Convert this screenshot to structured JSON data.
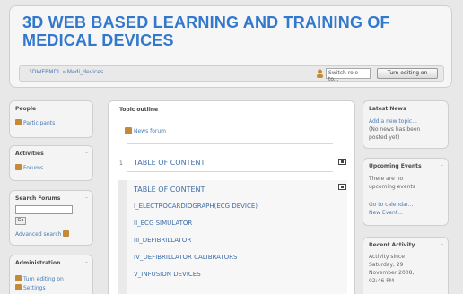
{
  "header": {
    "site_title": "3D WEB BASED LEARNING AND TRAINING OF MEDICAL DEVICES",
    "breadcrumb": "3DWEBMDL » Medi_devices",
    "role_select": "Switch role to...",
    "edit_button": "Turn editing on"
  },
  "left_blocks": {
    "people": {
      "title": "People",
      "items": [
        "Participants"
      ]
    },
    "activities": {
      "title": "Activities",
      "items": [
        "Forums"
      ]
    },
    "search": {
      "title": "Search Forums",
      "go": "Go",
      "advanced": "Advanced search"
    },
    "admin": {
      "title": "Administration",
      "items": [
        "Turn editing on",
        "Settings"
      ]
    }
  },
  "main": {
    "title": "Topic outline",
    "news_forum": "News forum",
    "section_num": "1",
    "section_link": "TABLE OF CONTENT",
    "topics": [
      "TABLE OF CONTENT",
      "I_ELECTROCARDIOGRAPH(ECG DEVICE)",
      "II_ECG SIMULATOR",
      "III_DEFIBRILLATOR",
      "IV_DEFIBRILLATOR CALIBRATORS",
      "V_INFUSION DEVICES"
    ]
  },
  "right_blocks": {
    "news": {
      "title": "Latest News",
      "lines": [
        "Add a new topic...",
        "(No news has been",
        "posted yet)"
      ]
    },
    "events": {
      "title": "Upcoming Events",
      "lines": [
        "There are no",
        "upcoming events",
        "Go to calendar...",
        "New Event..."
      ]
    },
    "activity": {
      "title": "Recent Activity",
      "lines": [
        "Activity since",
        "Saturday, 29",
        "November 2008,",
        "02:46 PM"
      ]
    }
  }
}
